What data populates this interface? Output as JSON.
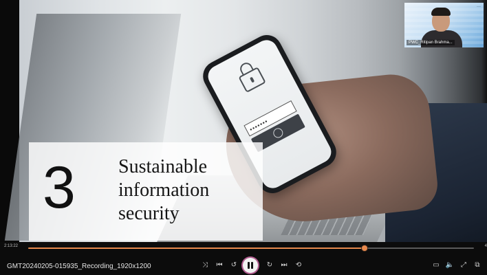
{
  "slide": {
    "number": "3",
    "title_lines": [
      "Sustainable",
      "information",
      "security"
    ],
    "password_mask": "•••••••"
  },
  "webcam": {
    "participant_name": "PWC_Ritipan Brahma...",
    "options_glyph": "···"
  },
  "player": {
    "file_name": "GMT20240205-015935_Recording_1920x1200",
    "current_time": "2:13:22",
    "total_time": "4",
    "progress": 0.755,
    "accent_color": "#e8894d",
    "buttons": [
      {
        "name": "shuffle-icon",
        "glyph": "⤨"
      },
      {
        "name": "previous-icon",
        "glyph": "⏮"
      },
      {
        "name": "rewind-10-icon",
        "glyph": "↺"
      },
      {
        "name": "pause-icon",
        "glyph": "❚❚"
      },
      {
        "name": "forward-30-icon",
        "glyph": "↻"
      },
      {
        "name": "next-icon",
        "glyph": "⏭"
      },
      {
        "name": "repeat-icon",
        "glyph": "⟲"
      },
      {
        "name": "subtitles-icon",
        "glyph": "▭"
      },
      {
        "name": "volume-icon",
        "glyph": "🔈"
      },
      {
        "name": "fullscreen-icon",
        "glyph": "⤢"
      },
      {
        "name": "miniplayer-icon",
        "glyph": "⧉"
      }
    ]
  }
}
